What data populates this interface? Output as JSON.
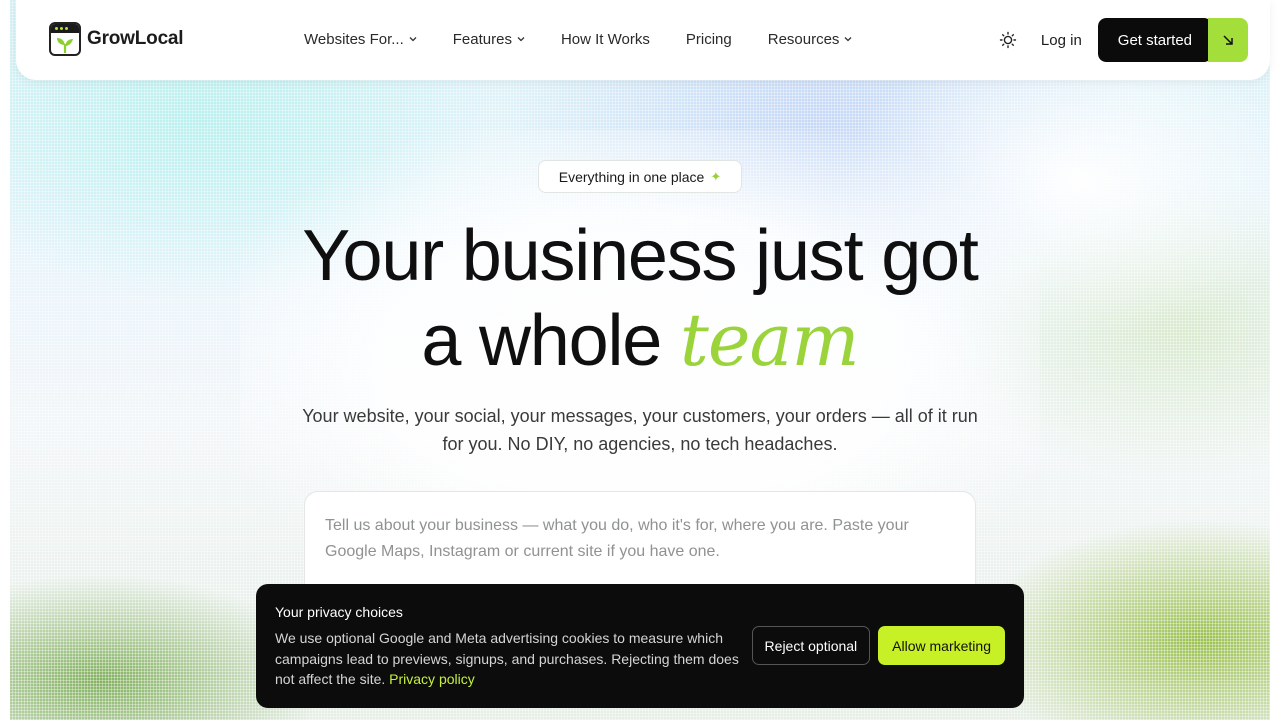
{
  "brand": {
    "name": "GrowLocal",
    "accent_color": "#a4de3a",
    "logo_icon": "sprout-window-icon"
  },
  "nav": {
    "items": [
      {
        "label": "Websites For...",
        "has_dropdown": true
      },
      {
        "label": "Features",
        "has_dropdown": true
      },
      {
        "label": "How It Works",
        "has_dropdown": false
      },
      {
        "label": "Pricing",
        "has_dropdown": false
      },
      {
        "label": "Resources",
        "has_dropdown": true
      }
    ],
    "theme_toggle_icon": "sun-icon",
    "login_label": "Log in",
    "cta_label": "Get started",
    "cta_icon": "arrow-down-right-icon"
  },
  "hero": {
    "badge_label": "Everything in one place",
    "badge_icon": "sparkle-icon",
    "headline_line1": "Your business just got",
    "headline_line2_prefix": "a whole ",
    "headline_accent": "team",
    "subheadline": "Your website, your social, your messages, your customers, your orders — all of it run for you. No DIY, no agencies, no tech headaches.",
    "input_placeholder": "Tell us about your business — what you do, who it's for, where you are. Paste your Google Maps, Instagram or current site if you have one."
  },
  "privacy": {
    "title": "Your privacy choices",
    "text": "We use optional Google and Meta advertising cookies to measure which campaigns lead to previews, signups, and purchases. Rejecting them does not affect the site.",
    "link_label": "Privacy policy",
    "reject_label": "Reject optional",
    "allow_label": "Allow marketing",
    "allow_color": "#c8f027"
  }
}
